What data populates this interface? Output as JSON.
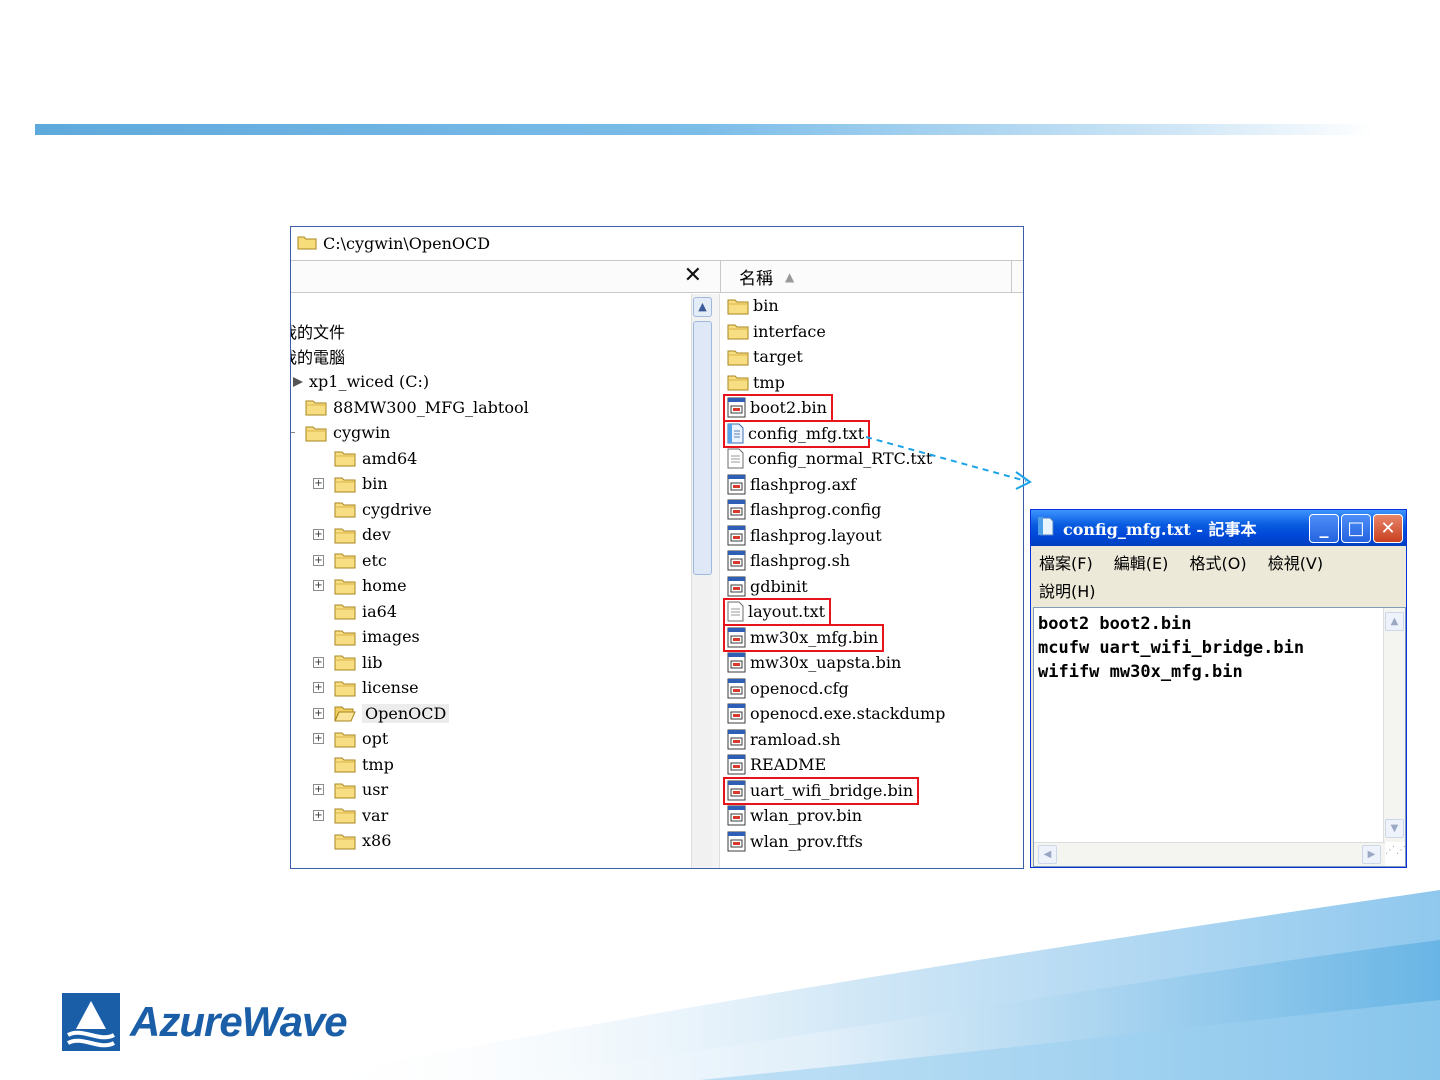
{
  "explorer": {
    "address": "C:\\cygwin\\OpenOCD",
    "close_symbol": "✕",
    "column_name": "名稱",
    "tree": [
      {
        "label": "我的文件",
        "indent": 0,
        "icon": "none",
        "expander": "none"
      },
      {
        "label": "我的電腦",
        "indent": 0,
        "icon": "none",
        "expander": "none"
      },
      {
        "label": "xp1_wiced (C:)",
        "indent": 0,
        "icon": "drive",
        "expander": "none"
      },
      {
        "label": "88MW300_MFG_labtool",
        "indent": 1,
        "icon": "folder",
        "expander": "none"
      },
      {
        "label": "cygwin",
        "indent": 1,
        "icon": "folder",
        "expander": "minus"
      },
      {
        "label": "amd64",
        "indent": 2,
        "icon": "folder",
        "expander": "none"
      },
      {
        "label": "bin",
        "indent": 2,
        "icon": "folder",
        "expander": "plus"
      },
      {
        "label": "cygdrive",
        "indent": 2,
        "icon": "folder",
        "expander": "none"
      },
      {
        "label": "dev",
        "indent": 2,
        "icon": "folder",
        "expander": "plus"
      },
      {
        "label": "etc",
        "indent": 2,
        "icon": "folder",
        "expander": "plus"
      },
      {
        "label": "home",
        "indent": 2,
        "icon": "folder",
        "expander": "plus"
      },
      {
        "label": "ia64",
        "indent": 2,
        "icon": "folder",
        "expander": "none"
      },
      {
        "label": "images",
        "indent": 2,
        "icon": "folder",
        "expander": "none"
      },
      {
        "label": "lib",
        "indent": 2,
        "icon": "folder",
        "expander": "plus"
      },
      {
        "label": "license",
        "indent": 2,
        "icon": "folder",
        "expander": "plus"
      },
      {
        "label": "OpenOCD",
        "indent": 2,
        "icon": "folder-open",
        "expander": "plus",
        "selected": true
      },
      {
        "label": "opt",
        "indent": 2,
        "icon": "folder",
        "expander": "plus"
      },
      {
        "label": "tmp",
        "indent": 2,
        "icon": "folder",
        "expander": "none"
      },
      {
        "label": "usr",
        "indent": 2,
        "icon": "folder",
        "expander": "plus"
      },
      {
        "label": "var",
        "indent": 2,
        "icon": "folder",
        "expander": "plus"
      },
      {
        "label": "x86",
        "indent": 2,
        "icon": "folder",
        "expander": "none"
      }
    ],
    "files": [
      {
        "name": "bin",
        "icon": "folder"
      },
      {
        "name": "interface",
        "icon": "folder"
      },
      {
        "name": "target",
        "icon": "folder"
      },
      {
        "name": "tmp",
        "icon": "folder"
      },
      {
        "name": "boot2.bin",
        "icon": "binary",
        "highlight": true
      },
      {
        "name": "config_mfg.txt",
        "icon": "notepad-file",
        "highlight": true
      },
      {
        "name": "config_normal_RTC.txt",
        "icon": "text-file"
      },
      {
        "name": "flashprog.axf",
        "icon": "binary"
      },
      {
        "name": "flashprog.config",
        "icon": "binary"
      },
      {
        "name": "flashprog.layout",
        "icon": "binary"
      },
      {
        "name": "flashprog.sh",
        "icon": "binary"
      },
      {
        "name": "gdbinit",
        "icon": "binary"
      },
      {
        "name": "layout.txt",
        "icon": "text-file",
        "highlight": true
      },
      {
        "name": "mw30x_mfg.bin",
        "icon": "binary",
        "highlight": true
      },
      {
        "name": "mw30x_uapsta.bin",
        "icon": "binary"
      },
      {
        "name": "openocd.cfg",
        "icon": "binary"
      },
      {
        "name": "openocd.exe.stackdump",
        "icon": "binary"
      },
      {
        "name": "ramload.sh",
        "icon": "binary"
      },
      {
        "name": "README",
        "icon": "binary"
      },
      {
        "name": "uart_wifi_bridge.bin",
        "icon": "binary",
        "highlight": true
      },
      {
        "name": "wlan_prov.bin",
        "icon": "binary"
      },
      {
        "name": "wlan_prov.ftfs",
        "icon": "binary"
      }
    ]
  },
  "notepad": {
    "title": "config_mfg.txt - 記事本",
    "menu": [
      "檔案(F)",
      "編輯(E)",
      "格式(O)",
      "檢視(V)",
      "說明(H)"
    ],
    "lines": [
      "boot2 boot2.bin",
      "mcufw uart_wifi_bridge.bin",
      "wififw mw30x_mfg.bin"
    ],
    "minimize": "_",
    "maximize": "□",
    "close": "✕"
  },
  "logo": {
    "text": "AzureWave"
  },
  "colors": {
    "highlight": "#e8141c",
    "arrow": "#1aa3e8",
    "accent_bar": "#5ea9dc",
    "logo": "#1b5ea8"
  }
}
